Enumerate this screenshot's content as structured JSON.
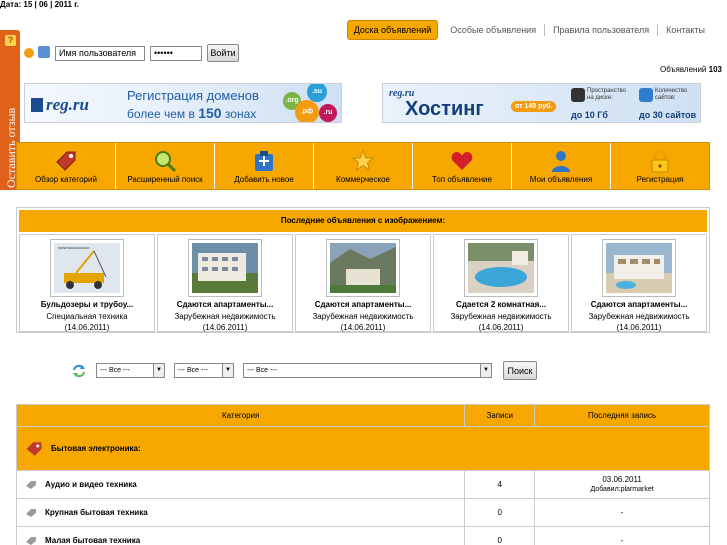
{
  "date_label": "Дата: 15 | 06 | 2011 г.",
  "feedback_tab": {
    "label": "Оставить отзыв",
    "icon": "question-icon",
    "glyph": "?"
  },
  "topnav": {
    "items": [
      "Доска объявлений",
      "Особые объявления",
      "Правила пользователя",
      "Контакты"
    ],
    "active": "Доска объявлений"
  },
  "login": {
    "username_value": "Имя пользователя",
    "password_value": "••••••",
    "submit_label": "Войти"
  },
  "ad_count": {
    "label": "Объявлений",
    "value": "103"
  },
  "banners": [
    {
      "logo": "reg.ru",
      "headline": "Регистрация доменов",
      "sub_prefix": "более чем в",
      "sub_number": "150",
      "sub_suffix": "зонах",
      "dots": [
        ".org",
        ".su",
        ".рф",
        ".ru"
      ]
    },
    {
      "logo": "reg.ru",
      "headline": "Хостинг",
      "price": "от 149 руб.",
      "item1_small": "Пространство на диске:",
      "item1_big": "до 10 Гб",
      "item2_small": "Количество сайтов:",
      "item2_big": "до 30 сайтов"
    }
  ],
  "menu": [
    {
      "label": "Обзор категорий",
      "icon": "tag-icon"
    },
    {
      "label": "Расширенный поиск",
      "icon": "search-icon"
    },
    {
      "label": "Добавить новое",
      "icon": "add-document-icon"
    },
    {
      "label": "Коммерческое",
      "icon": "star-icon"
    },
    {
      "label": "Топ объявление",
      "icon": "heart-icon"
    },
    {
      "label": "Мои объявления",
      "icon": "user-icon"
    },
    {
      "label": "Регистрация",
      "icon": "lock-icon"
    }
  ],
  "latest": {
    "title": "Последние объявления с изображением:",
    "items": [
      {
        "title": "Бульдозеры и трубоу...",
        "category": "Специальная техника",
        "date": "(14.06.2011)",
        "caption": "www.ssoooooooo"
      },
      {
        "title": "Сдаются апартаменты...",
        "category": "Зарубежная недвижимость",
        "date": "(14.06.2011)"
      },
      {
        "title": "Сдаются апартаменты...",
        "category": "Зарубежная недвижимость",
        "date": "(14.06.2011)"
      },
      {
        "title": "Сдается 2 комнатная...",
        "category": "Зарубежная недвижимость",
        "date": "(14.06.2011)"
      },
      {
        "title": "Сдаются апартаменты...",
        "category": "Зарубежная недвижимость",
        "date": "(14.06.2011)"
      }
    ]
  },
  "filters": {
    "select1": "--- Все ---",
    "select2": "--- Все ---",
    "select3": "--- Все ---",
    "search_label": "Поиск"
  },
  "categories": {
    "headers": [
      "Категория",
      "Записи",
      "Последняя запись"
    ],
    "group": "Бытовая электроника:",
    "rows": [
      {
        "name": "Аудио и видео техника",
        "count": "4",
        "last_date": "03.06.2011",
        "last_by": "Добавил:plarmarket"
      },
      {
        "name": "Крупная бытовая техника",
        "count": "0",
        "last_date": "-",
        "last_by": ""
      },
      {
        "name": "Малая бытовая техника",
        "count": "0",
        "last_date": "-",
        "last_by": ""
      }
    ]
  },
  "colors": {
    "accent": "#f7a800",
    "link": "#1f5ea8",
    "feedback": "#e0611a"
  }
}
